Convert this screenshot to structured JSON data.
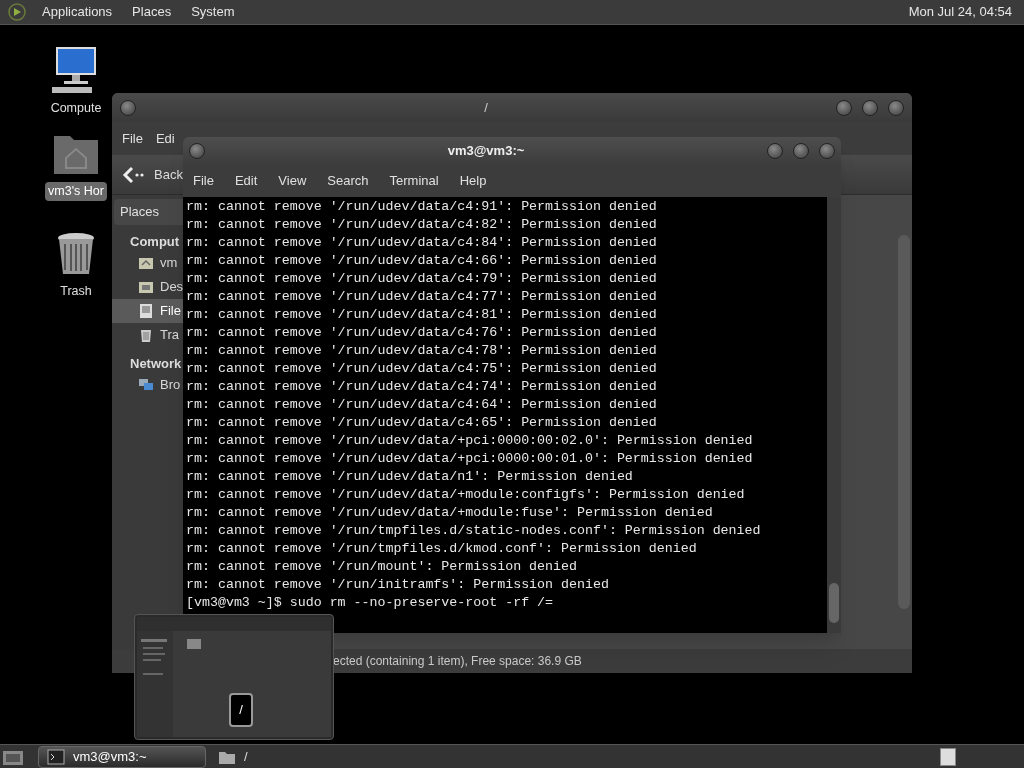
{
  "top_panel": {
    "menus": [
      "Applications",
      "Places",
      "System"
    ],
    "clock": "Mon Jul 24, 04:54"
  },
  "desktop_icons": [
    {
      "label": "Compute",
      "kind": "computer",
      "selected": false
    },
    {
      "label": "vm3's Hor",
      "kind": "home",
      "selected": true
    },
    {
      "label": "Trash",
      "kind": "trash",
      "selected": false
    }
  ],
  "file_manager": {
    "title": "/",
    "menu": [
      "File",
      "Edi"
    ],
    "back_label": "Back",
    "sidebar_tab": "Places",
    "sidebar": [
      {
        "kind": "heading",
        "label": "Comput"
      },
      {
        "kind": "home",
        "label": "vm",
        "selected": false
      },
      {
        "kind": "desktop",
        "label": "Des",
        "selected": false
      },
      {
        "kind": "drive",
        "label": "File",
        "selected": true
      },
      {
        "kind": "trash",
        "label": "Tra",
        "selected": false
      },
      {
        "kind": "heading",
        "label": "Network"
      },
      {
        "kind": "network",
        "label": "Bro",
        "selected": false
      }
    ],
    "status": "ected (containing 1 item), Free space: 36.9 GB"
  },
  "terminal": {
    "title": "vm3@vm3:~",
    "menu": [
      "File",
      "Edit",
      "View",
      "Search",
      "Terminal",
      "Help"
    ],
    "lines": [
      "rm: cannot remove '/run/udev/data/c4:91': Permission denied",
      "rm: cannot remove '/run/udev/data/c4:82': Permission denied",
      "rm: cannot remove '/run/udev/data/c4:84': Permission denied",
      "rm: cannot remove '/run/udev/data/c4:66': Permission denied",
      "rm: cannot remove '/run/udev/data/c4:79': Permission denied",
      "rm: cannot remove '/run/udev/data/c4:77': Permission denied",
      "rm: cannot remove '/run/udev/data/c4:81': Permission denied",
      "rm: cannot remove '/run/udev/data/c4:76': Permission denied",
      "rm: cannot remove '/run/udev/data/c4:78': Permission denied",
      "rm: cannot remove '/run/udev/data/c4:75': Permission denied",
      "rm: cannot remove '/run/udev/data/c4:74': Permission denied",
      "rm: cannot remove '/run/udev/data/c4:64': Permission denied",
      "rm: cannot remove '/run/udev/data/c4:65': Permission denied",
      "rm: cannot remove '/run/udev/data/+pci:0000:00:02.0': Permission denied",
      "rm: cannot remove '/run/udev/data/+pci:0000:00:01.0': Permission denied",
      "rm: cannot remove '/run/udev/data/n1': Permission denied",
      "rm: cannot remove '/run/udev/data/+module:configfs': Permission denied",
      "rm: cannot remove '/run/udev/data/+module:fuse': Permission denied",
      "rm: cannot remove '/run/tmpfiles.d/static-nodes.conf': Permission denied",
      "rm: cannot remove '/run/tmpfiles.d/kmod.conf': Permission denied",
      "rm: cannot remove '/run/mount': Permission denied",
      "rm: cannot remove '/run/initramfs': Permission denied",
      "[vm3@vm3 ~]$ sudo rm --no-preserve-root -rf /="
    ]
  },
  "preview": {
    "label": "/"
  },
  "taskbar": {
    "tasks": [
      {
        "kind": "terminal",
        "label": "vm3@vm3:~",
        "selected": true
      },
      {
        "kind": "folder",
        "label": "/",
        "selected": false
      }
    ]
  }
}
